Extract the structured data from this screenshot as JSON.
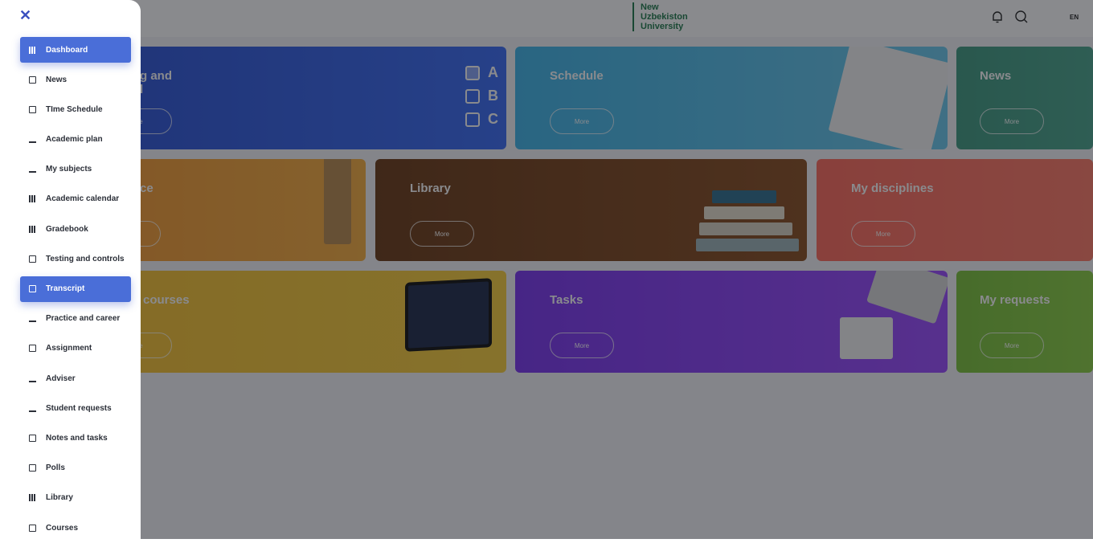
{
  "header": {
    "brand_lines": [
      "New",
      "Uzbekiston",
      "University"
    ],
    "language": "EN",
    "icons": [
      "bell-icon",
      "chat-icon"
    ]
  },
  "cards": {
    "testing": {
      "title": "g and\nl",
      "more": "re",
      "options": [
        "A",
        "B",
        "C"
      ]
    },
    "schedule": {
      "title": "Schedule",
      "more": "More"
    },
    "news": {
      "title": "News",
      "more": "More"
    },
    "attendance": {
      "title": "ce",
      "more": ""
    },
    "library": {
      "title": "Library",
      "more": "More"
    },
    "disciplines": {
      "title": "My disciplines",
      "more": "More"
    },
    "courses": {
      "title": "courses",
      "more": "re"
    },
    "tasks": {
      "title": "Tasks",
      "more": "More"
    },
    "requests": {
      "title": "My requests",
      "more": "More"
    }
  },
  "sidebar": {
    "close_icon": "close-icon",
    "items": [
      {
        "label": "Dashboard",
        "active": true,
        "icon": "dashboard-icon"
      },
      {
        "label": "News",
        "active": false,
        "icon": "news-icon"
      },
      {
        "label": "TIme Schedule",
        "active": false,
        "icon": "calendar-icon"
      },
      {
        "label": "Academic plan",
        "active": false,
        "icon": "graduation-cap-icon"
      },
      {
        "label": "My subjects",
        "active": false,
        "icon": "subjects-icon"
      },
      {
        "label": "Academic calendar",
        "active": false,
        "icon": "calendar-grid-icon"
      },
      {
        "label": "Gradebook",
        "active": false,
        "icon": "gradebook-icon"
      },
      {
        "label": "Testing and controls",
        "active": false,
        "icon": "test-icon"
      },
      {
        "label": "Transcript",
        "active": true,
        "icon": "transcript-icon"
      },
      {
        "label": "Practice and career",
        "active": false,
        "icon": "career-chart-icon"
      },
      {
        "label": "Assignment",
        "active": false,
        "icon": "assignment-icon"
      },
      {
        "label": "Adviser",
        "active": false,
        "icon": "adviser-icon"
      },
      {
        "label": "Student requests",
        "active": false,
        "icon": "requests-icon"
      },
      {
        "label": "Notes and tasks",
        "active": false,
        "icon": "notes-icon"
      },
      {
        "label": "Polls",
        "active": false,
        "icon": "polls-icon"
      },
      {
        "label": "Library",
        "active": false,
        "icon": "library-icon"
      },
      {
        "label": "Courses",
        "active": false,
        "icon": "courses-icon"
      }
    ]
  },
  "colors": {
    "brand_green": "#1f7a4a",
    "sidebar_active": "#4a6ed8"
  }
}
